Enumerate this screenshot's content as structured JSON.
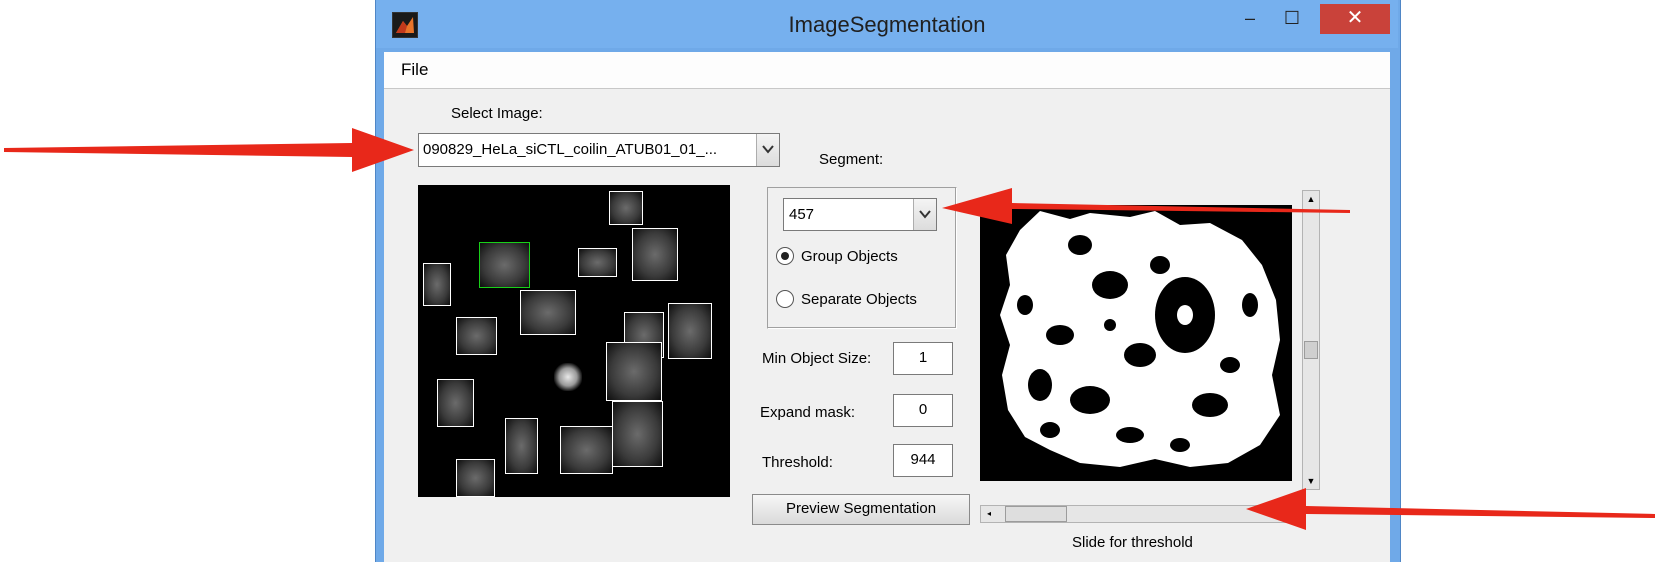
{
  "window": {
    "title": "ImageSegmentation",
    "minimize": "‒",
    "maximize": "☐",
    "close": "✕"
  },
  "menu": {
    "file": "File"
  },
  "select_image": {
    "label": "Select Image:",
    "value": "090829_HeLa_siCTL_coilin_ATUB01_01_..."
  },
  "segment": {
    "label": "Segment:",
    "value": "457",
    "options": [
      {
        "label": "Group Objects",
        "selected": true
      },
      {
        "label": "Separate Objects",
        "selected": false
      }
    ]
  },
  "params": {
    "min_object_size": {
      "label": "Min Object Size:",
      "value": "1"
    },
    "expand_mask": {
      "label": "Expand mask:",
      "value": "0"
    },
    "threshold": {
      "label": "Threshold:",
      "value": "944"
    }
  },
  "preview_button": "Preview Segmentation",
  "slider": {
    "label": "Slide for threshold"
  },
  "icons": {
    "dropdown": "chevron-down-icon",
    "arrow": "red-arrow-annotation"
  },
  "colors": {
    "titlebar": "#76b0ee",
    "close": "#c9423a",
    "annotation": "#e8281a",
    "selection": "#19d019"
  }
}
